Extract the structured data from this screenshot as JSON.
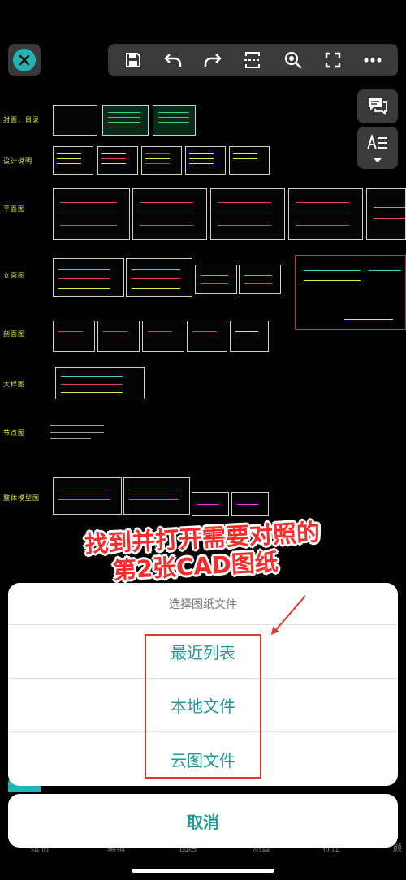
{
  "toolbar": {
    "close_icon": "close-icon",
    "items": [
      "save-icon",
      "undo-icon",
      "redo-icon",
      "fit-width-icon",
      "zoom-icon",
      "fullscreen-icon",
      "more-icon"
    ],
    "accent": "#27b3b3"
  },
  "side_tools": [
    "comment-icon",
    "text-style-icon"
  ],
  "drawing": {
    "row_labels": [
      "封面、目录",
      "设计说明",
      "平面图",
      "立面图",
      "剖面图",
      "大样图",
      "节点图",
      "整体模型图"
    ]
  },
  "annotation": {
    "line1": "找到并打开需要对照的",
    "line2": "第2张CAD图纸",
    "color": "#ff2b2b"
  },
  "action_sheet": {
    "title": "选择图纸文件",
    "options": [
      "最近列表",
      "本地文件",
      "云图文件"
    ],
    "cancel": "取消",
    "accent": "#1f9a9a"
  },
  "tabs": [
    "绘制",
    "编辑",
    "图层",
    "测量",
    "标注",
    "颜"
  ]
}
